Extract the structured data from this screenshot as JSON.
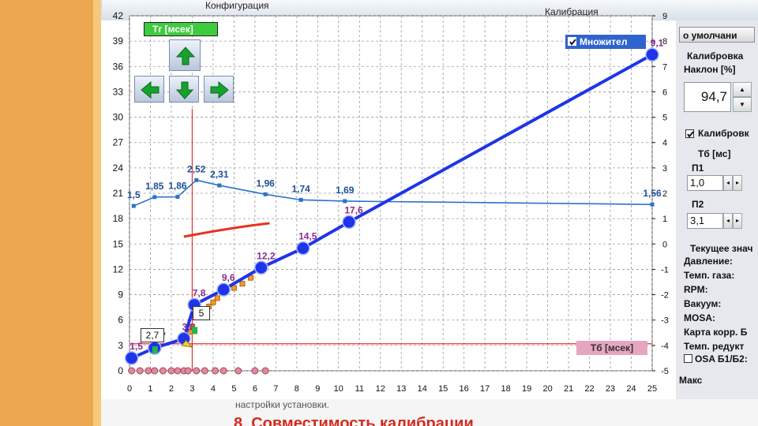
{
  "tabs": {
    "config": "Конфигурация",
    "calibration": "Калибрация"
  },
  "chart": {
    "tg_label": "Tг [мсек]",
    "tb_label": "Tб [мсек]",
    "multiplier_label": "Множител",
    "multiplier_checked": true
  },
  "chart_data": {
    "type": "line",
    "xlabel": "Tб [мсек]",
    "ylabel": "Tг [мсек]",
    "xlim": [
      0,
      25
    ],
    "ylim_left": [
      0,
      42
    ],
    "ylim_right": [
      -5,
      9
    ],
    "x_ticks": [
      "0",
      "1",
      "2",
      "3",
      "4",
      "5",
      "6",
      "7",
      "8",
      "9",
      "10",
      "11",
      "12",
      "13",
      "14",
      "15",
      "16",
      "17",
      "18",
      "19",
      "20",
      "21",
      "22",
      "23",
      "24",
      "25"
    ],
    "y_left_ticks": [
      "0",
      "3",
      "6",
      "9",
      "12",
      "15",
      "18",
      "21",
      "24",
      "27",
      "30",
      "33",
      "36",
      "39",
      "42"
    ],
    "y_right_ticks": [
      "-5",
      "-4",
      "-3",
      "-2",
      "-1",
      "0",
      "1",
      "2",
      "3",
      "4",
      "5",
      "6",
      "7",
      "8",
      "9"
    ],
    "grid": true,
    "calibration_points": [
      {
        "x": 0.1,
        "y": 1.5,
        "label": "1,5"
      },
      {
        "x": 1.2,
        "y": 2.7,
        "label": "2,7"
      },
      {
        "x": 2.6,
        "y": 3.8,
        "label": "3,8"
      },
      {
        "x": 3.1,
        "y": 7.8,
        "label": "7,8"
      },
      {
        "x": 4.5,
        "y": 9.6,
        "label": "9,6"
      },
      {
        "x": 6.3,
        "y": 12.2,
        "label": "12,2"
      },
      {
        "x": 8.3,
        "y": 14.5,
        "label": "14,5"
      },
      {
        "x": 10.5,
        "y": 17.6,
        "label": "17,6"
      },
      {
        "x": 25.0,
        "y": 37.4,
        "label": "9,1"
      }
    ],
    "multiplier_points": [
      {
        "x": 0.2,
        "y": 1.5,
        "label": "1,5"
      },
      {
        "x": 1.2,
        "y": 1.85,
        "label": "1,85"
      },
      {
        "x": 2.3,
        "y": 1.86,
        "label": "1,86"
      },
      {
        "x": 3.2,
        "y": 2.52,
        "label": "2,52"
      },
      {
        "x": 4.3,
        "y": 2.31,
        "label": "2,31"
      },
      {
        "x": 6.5,
        "y": 1.96,
        "label": "1,96"
      },
      {
        "x": 8.2,
        "y": 1.74,
        "label": "1,74"
      },
      {
        "x": 10.3,
        "y": 1.69,
        "label": "1,69"
      },
      {
        "x": 25.0,
        "y": 1.56,
        "label": "1,56"
      }
    ],
    "current_values": [
      {
        "x": 1.6,
        "label": "2,7"
      },
      {
        "x": 3.1,
        "label": "5"
      }
    ],
    "colors": {
      "calibration": "#1f34e8",
      "multiplier": "#2a73c8",
      "red_curve": "#e8321e",
      "cursor": "#e9322a",
      "grid": "#9a9a9a"
    }
  },
  "nav": {
    "up": "up-arrow-icon",
    "left": "left-arrow-icon",
    "down": "down-arrow-icon",
    "right": "right-arrow-icon"
  },
  "panel": {
    "default_btn": "о умолчани",
    "calibration_title": "Калибровка",
    "slope_label": "Наклон [%]",
    "slope_value": "94,7",
    "calib2_label": "Калибровк",
    "tb_ms": "Tб [мс]",
    "p1_label": "П1",
    "p1_value": "1,0",
    "p2_label": "П2",
    "p2_value": "3,1",
    "current_title": "Текущее знач",
    "pressure": "Давление:",
    "gas_temp": "Темп. газа:",
    "rpm": "RPM:",
    "vacuum": "Вакуум:",
    "mosa": "MOSA:",
    "map_corr": "Карта корр. Б",
    "reducer_temp": "Темп. редукт",
    "osa": "OSA Б1/Б2:",
    "max": "Макс"
  },
  "bottom": {
    "line1": "настройки установки.",
    "line2": "8. Совместимость калибрации"
  }
}
